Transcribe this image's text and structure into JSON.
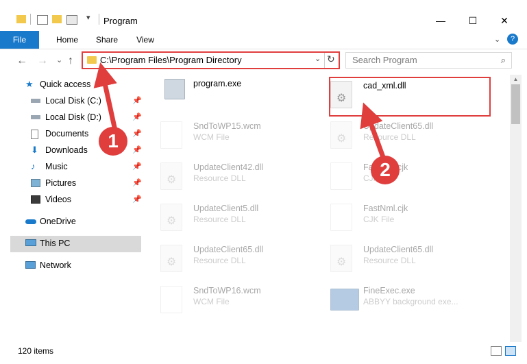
{
  "window": {
    "title": "Program",
    "minimize": "—",
    "maximize": "☐",
    "close": "✕"
  },
  "ribbon": {
    "tabs": [
      "File",
      "Home",
      "Share",
      "View"
    ],
    "help": "?"
  },
  "address": {
    "path": "C:\\Program Files\\Program Directory",
    "dropdown": "⌄",
    "refresh": "↻"
  },
  "search": {
    "placeholder": "Search Program",
    "icon": "⌕"
  },
  "nav": {
    "back": "←",
    "forward": "→",
    "recent": "⌄",
    "up": "↑",
    "items": [
      {
        "label": "Quick access",
        "icon": "star-icon",
        "pinned": false
      },
      {
        "label": "Local Disk (C:)",
        "icon": "drive-icon",
        "pinned": true
      },
      {
        "label": "Local Disk (D:)",
        "icon": "drive-icon",
        "pinned": true
      },
      {
        "label": "Documents",
        "icon": "documents-icon",
        "pinned": true
      },
      {
        "label": "Downloads",
        "icon": "downloads-icon",
        "pinned": true
      },
      {
        "label": "Music",
        "icon": "music-icon",
        "pinned": true
      },
      {
        "label": "Pictures",
        "icon": "pictures-icon",
        "pinned": true
      },
      {
        "label": "Videos",
        "icon": "videos-icon",
        "pinned": true
      },
      {
        "label": "OneDrive",
        "icon": "onedrive-icon",
        "pinned": false
      },
      {
        "label": "This PC",
        "icon": "pc-icon",
        "pinned": false
      },
      {
        "label": "Network",
        "icon": "network-icon",
        "pinned": false
      }
    ]
  },
  "files": [
    {
      "name": "program.exe",
      "type": ""
    },
    {
      "name": "cad_xml.dll",
      "type": ""
    },
    {
      "name": "SndToWP15.wcm",
      "type": "WCM File"
    },
    {
      "name": "UpdateClient65.dll",
      "type": "Resource DLL"
    },
    {
      "name": "UpdateClient42.dll",
      "type": "Resource DLL"
    },
    {
      "name": "FastNml.cjk",
      "type": "CJK File"
    },
    {
      "name": "UpdateClient5.dll",
      "type": "Resource DLL"
    },
    {
      "name": "FastNml.cjk",
      "type": "CJK File"
    },
    {
      "name": "UpdateClient65.dll",
      "type": "Resource DLL"
    },
    {
      "name": "UpdateClient65.dll",
      "type": "Resource DLL"
    },
    {
      "name": "SndToWP16.wcm",
      "type": "WCM File"
    },
    {
      "name": "FineExec.exe",
      "type": "ABBYY background exe..."
    }
  ],
  "status": {
    "item_count": "120 items"
  },
  "callouts": {
    "first": "1",
    "second": "2"
  },
  "colors": {
    "accent": "#1979ca",
    "callout": "#e03d3d",
    "selection": "#d9d9d9"
  }
}
